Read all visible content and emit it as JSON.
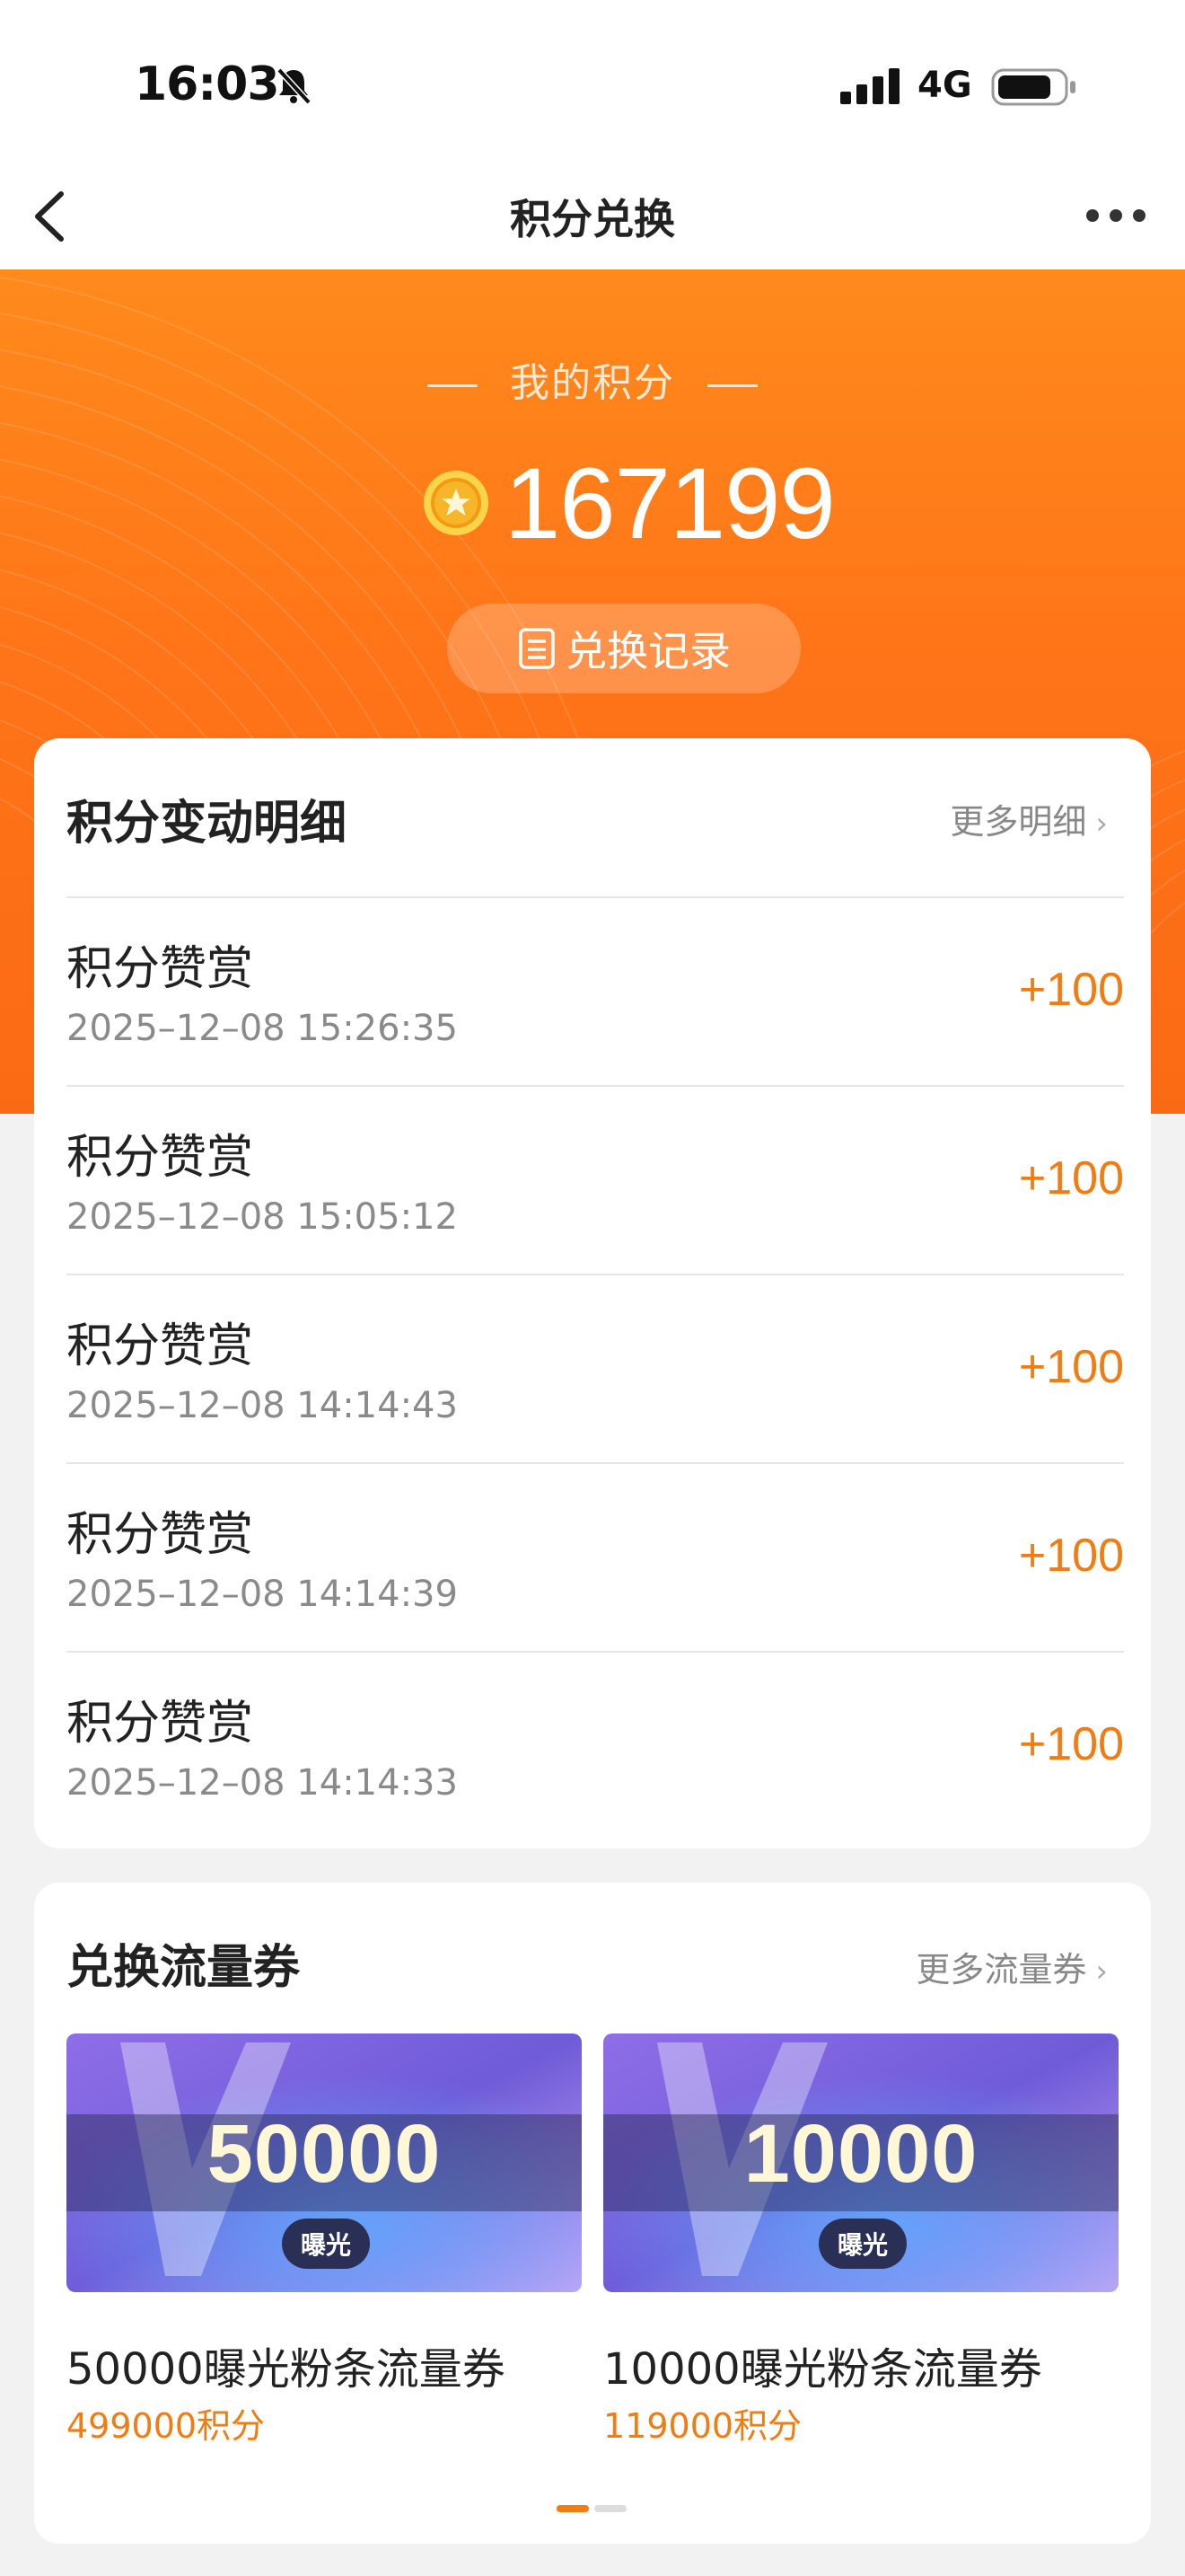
{
  "status_bar": {
    "time": "16:03",
    "network": "4G"
  },
  "nav": {
    "title": "积分兑换"
  },
  "hero": {
    "label": "我的积分",
    "points": "167199",
    "record_button": "兑换记录"
  },
  "detail": {
    "title": "积分变动明细",
    "more": "更多明细",
    "rows": [
      {
        "title": "积分赞赏",
        "time": "2025–12–08 15:26:35",
        "value": "+100"
      },
      {
        "title": "积分赞赏",
        "time": "2025–12–08 15:05:12",
        "value": "+100"
      },
      {
        "title": "积分赞赏",
        "time": "2025–12–08 14:14:43",
        "value": "+100"
      },
      {
        "title": "积分赞赏",
        "time": "2025–12–08 14:14:39",
        "value": "+100"
      },
      {
        "title": "积分赞赏",
        "time": "2025–12–08 14:14:33",
        "value": "+100"
      }
    ]
  },
  "vouchers": {
    "title": "兑换流量券",
    "more": "更多流量券",
    "items": [
      {
        "amount": "50000",
        "tag": "曝光",
        "name": "50000曝光粉条流量券",
        "price": "499000积分"
      },
      {
        "amount": "10000",
        "tag": "曝光",
        "name": "10000曝光粉条流量券",
        "price": "119000积分"
      }
    ]
  },
  "colors": {
    "accent": "#f07c12",
    "hero_orange": "#ff7418"
  }
}
